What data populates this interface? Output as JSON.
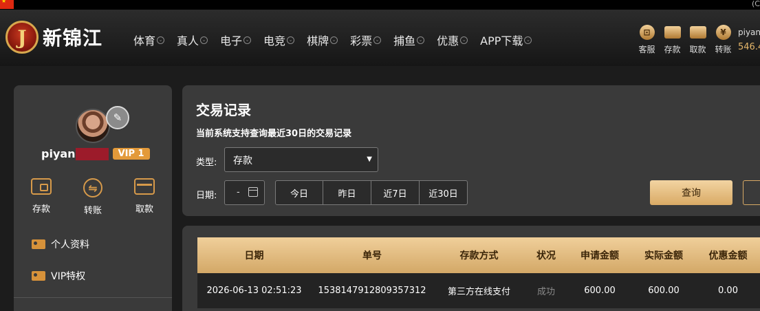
{
  "top": {
    "right_text": "(C"
  },
  "brand": {
    "logo_letter": "J",
    "name": "新锦江"
  },
  "nav": [
    {
      "label": "体育"
    },
    {
      "label": "真人"
    },
    {
      "label": "电子"
    },
    {
      "label": "电竞"
    },
    {
      "label": "棋牌"
    },
    {
      "label": "彩票"
    },
    {
      "label": "捕鱼"
    },
    {
      "label": "优惠"
    },
    {
      "label": "APP下载"
    }
  ],
  "quick_actions": [
    {
      "label": "客服",
      "icon": "customer-service-icon",
      "glyph": "⊡"
    },
    {
      "label": "存款",
      "icon": "deposit-wallet-icon",
      "glyph": ""
    },
    {
      "label": "取款",
      "icon": "withdraw-briefcase-icon",
      "glyph": ""
    },
    {
      "label": "转账",
      "icon": "transfer-coin-icon",
      "glyph": "¥"
    }
  ],
  "user": {
    "name": "piyan",
    "balance": "546.4"
  },
  "sidebar": {
    "username_visible": "piyan",
    "vip": "VIP 1",
    "actions": [
      {
        "label": "存款",
        "icon": "wallet-icon"
      },
      {
        "label": "转账",
        "icon": "transfer-icon",
        "glyph": "⇋"
      },
      {
        "label": "取款",
        "icon": "card-icon"
      }
    ],
    "menu": [
      {
        "label": "个人资料",
        "icon": "profile-card-icon"
      },
      {
        "label": "VIP特权",
        "icon": "vip-card-icon"
      }
    ]
  },
  "records": {
    "title": "交易记录",
    "subtitle": "当前系统支持查询最近30日的交易记录",
    "type_label": "类型:",
    "type_value": "存款",
    "date_label": "日期:",
    "date_value": "-",
    "ranges": [
      "今日",
      "昨日",
      "近7日",
      "近30日"
    ],
    "query_label": "查询"
  },
  "table": {
    "columns": [
      "日期",
      "单号",
      "存款方式",
      "状况",
      "申请金额",
      "实际金额",
      "优惠金额"
    ],
    "rows": [
      [
        "2026-06-13 02:51:23",
        "1538147912809357312",
        "第三方在线支付",
        "成功",
        "600.00",
        "600.00",
        "0.00"
      ]
    ]
  },
  "colors": {
    "accent_gold": "#d9aa65",
    "vip_orange": "#e39a3a",
    "panel": "#3a3a3a"
  }
}
